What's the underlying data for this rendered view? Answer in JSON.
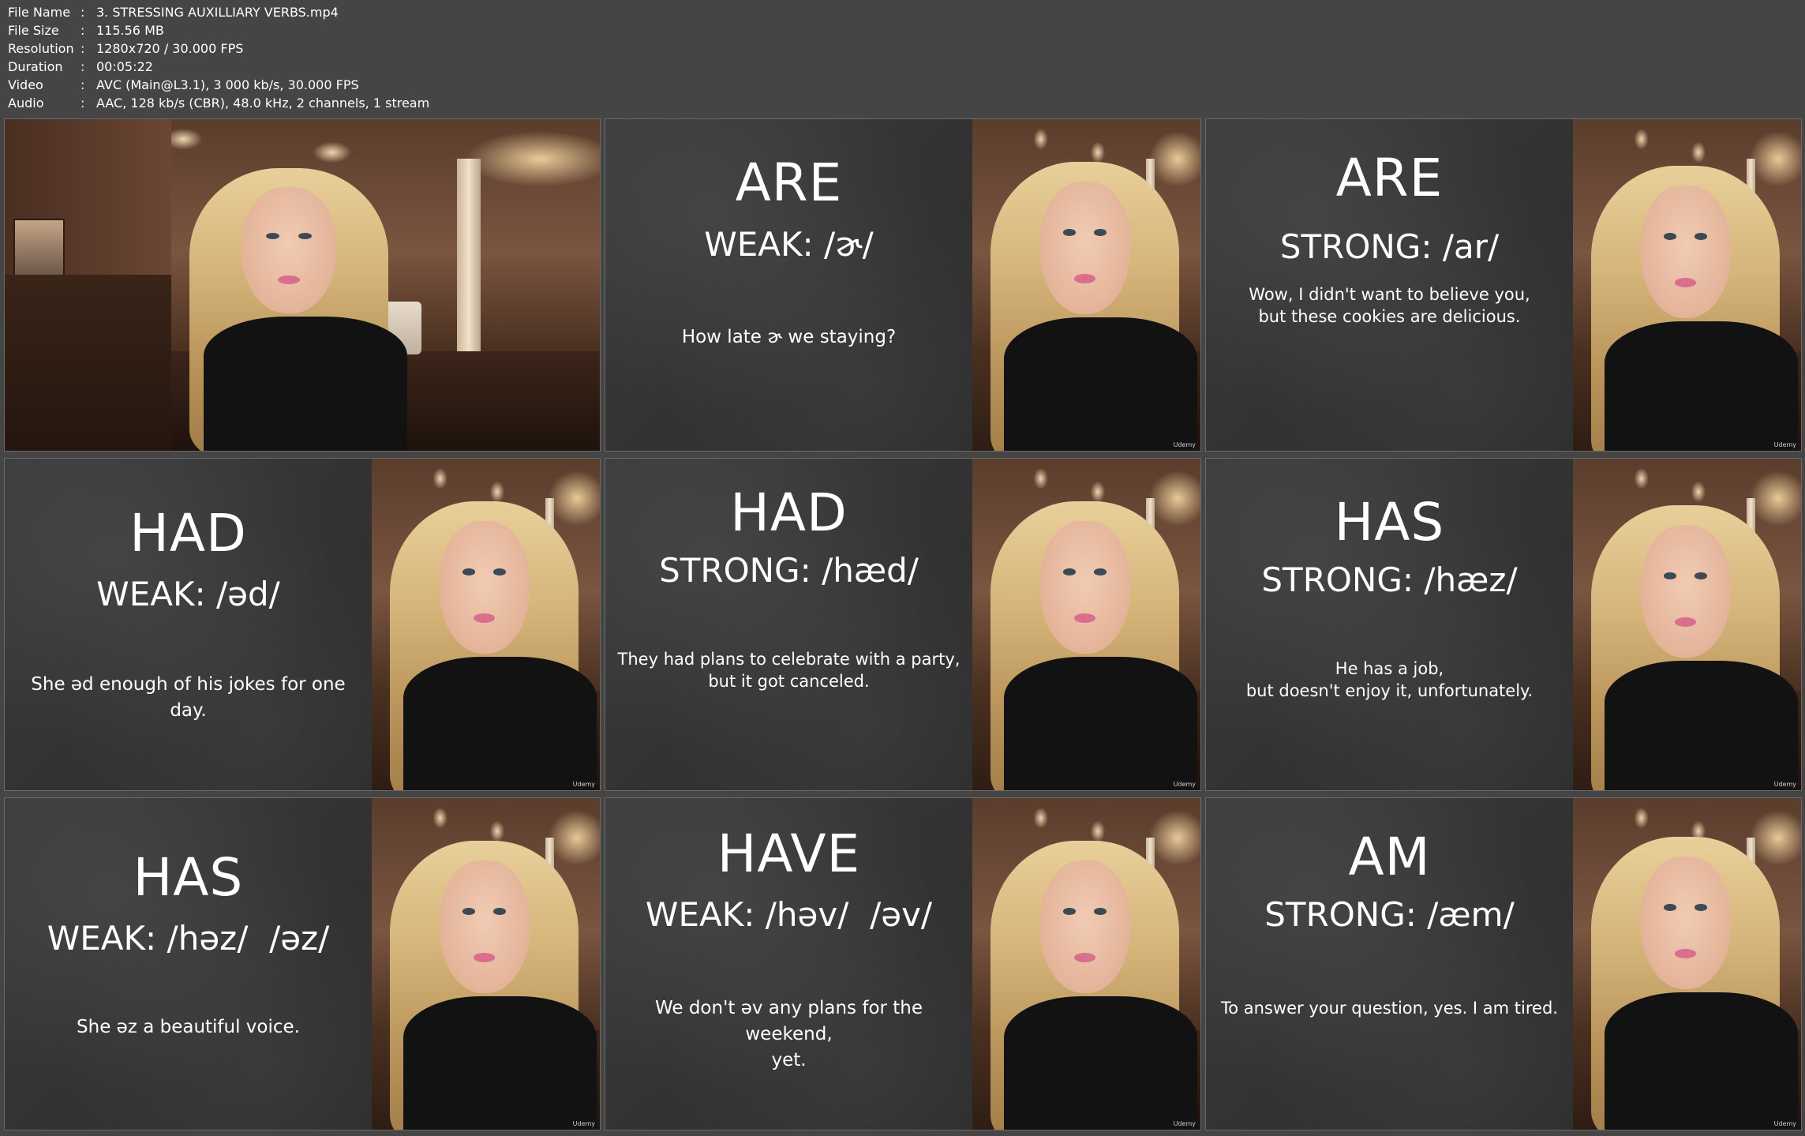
{
  "header": {
    "rows": [
      {
        "key": "File Name",
        "value": "3. STRESSING AUXILLIARY VERBS.mp4"
      },
      {
        "key": "File Size",
        "value": "115.56 MB"
      },
      {
        "key": "Resolution",
        "value": "1280x720 / 30.000 FPS"
      },
      {
        "key": "Duration",
        "value": "00:05:22"
      },
      {
        "key": "Video",
        "value": "AVC (Main@L3.1), 3 000 kb/s, 30.000 FPS"
      },
      {
        "key": "Audio",
        "value": "AAC, 128 kb/s (CBR), 48.0 kHz, 2 channels, 1 stream"
      }
    ],
    "separator": ":"
  },
  "brand": "Udemy",
  "thumbnails": [
    {
      "type": "camera"
    },
    {
      "word": "ARE",
      "phonetic": "WEAK: /ɚ/",
      "sentence": "How late ɚ we staying?"
    },
    {
      "word": "ARE",
      "phonetic": "STRONG: /ar/",
      "sentence": "Wow, I didn't want to believe you,\nbut these cookies are delicious."
    },
    {
      "word": "HAD",
      "phonetic": "WEAK: /əd/",
      "sentence": "She əd enough of his jokes for one day."
    },
    {
      "word": "HAD",
      "phonetic": "STRONG: /hæd/",
      "sentence": "They had plans to celebrate with a party,\nbut it got canceled."
    },
    {
      "word": "HAS",
      "phonetic": "STRONG: /hæz/",
      "sentence": "He has a job,\nbut doesn't enjoy it, unfortunately."
    },
    {
      "word": "HAS",
      "phonetic": "WEAK: /həz/  /əz/",
      "sentence": "She əz a beautiful voice."
    },
    {
      "word": "HAVE",
      "phonetic": "WEAK: /həv/  /əv/",
      "sentence": "We don't əv any plans for the weekend,\nyet."
    },
    {
      "word": "AM",
      "phonetic": "STRONG: /æm/",
      "sentence": "To answer your question, yes. I am tired."
    }
  ]
}
